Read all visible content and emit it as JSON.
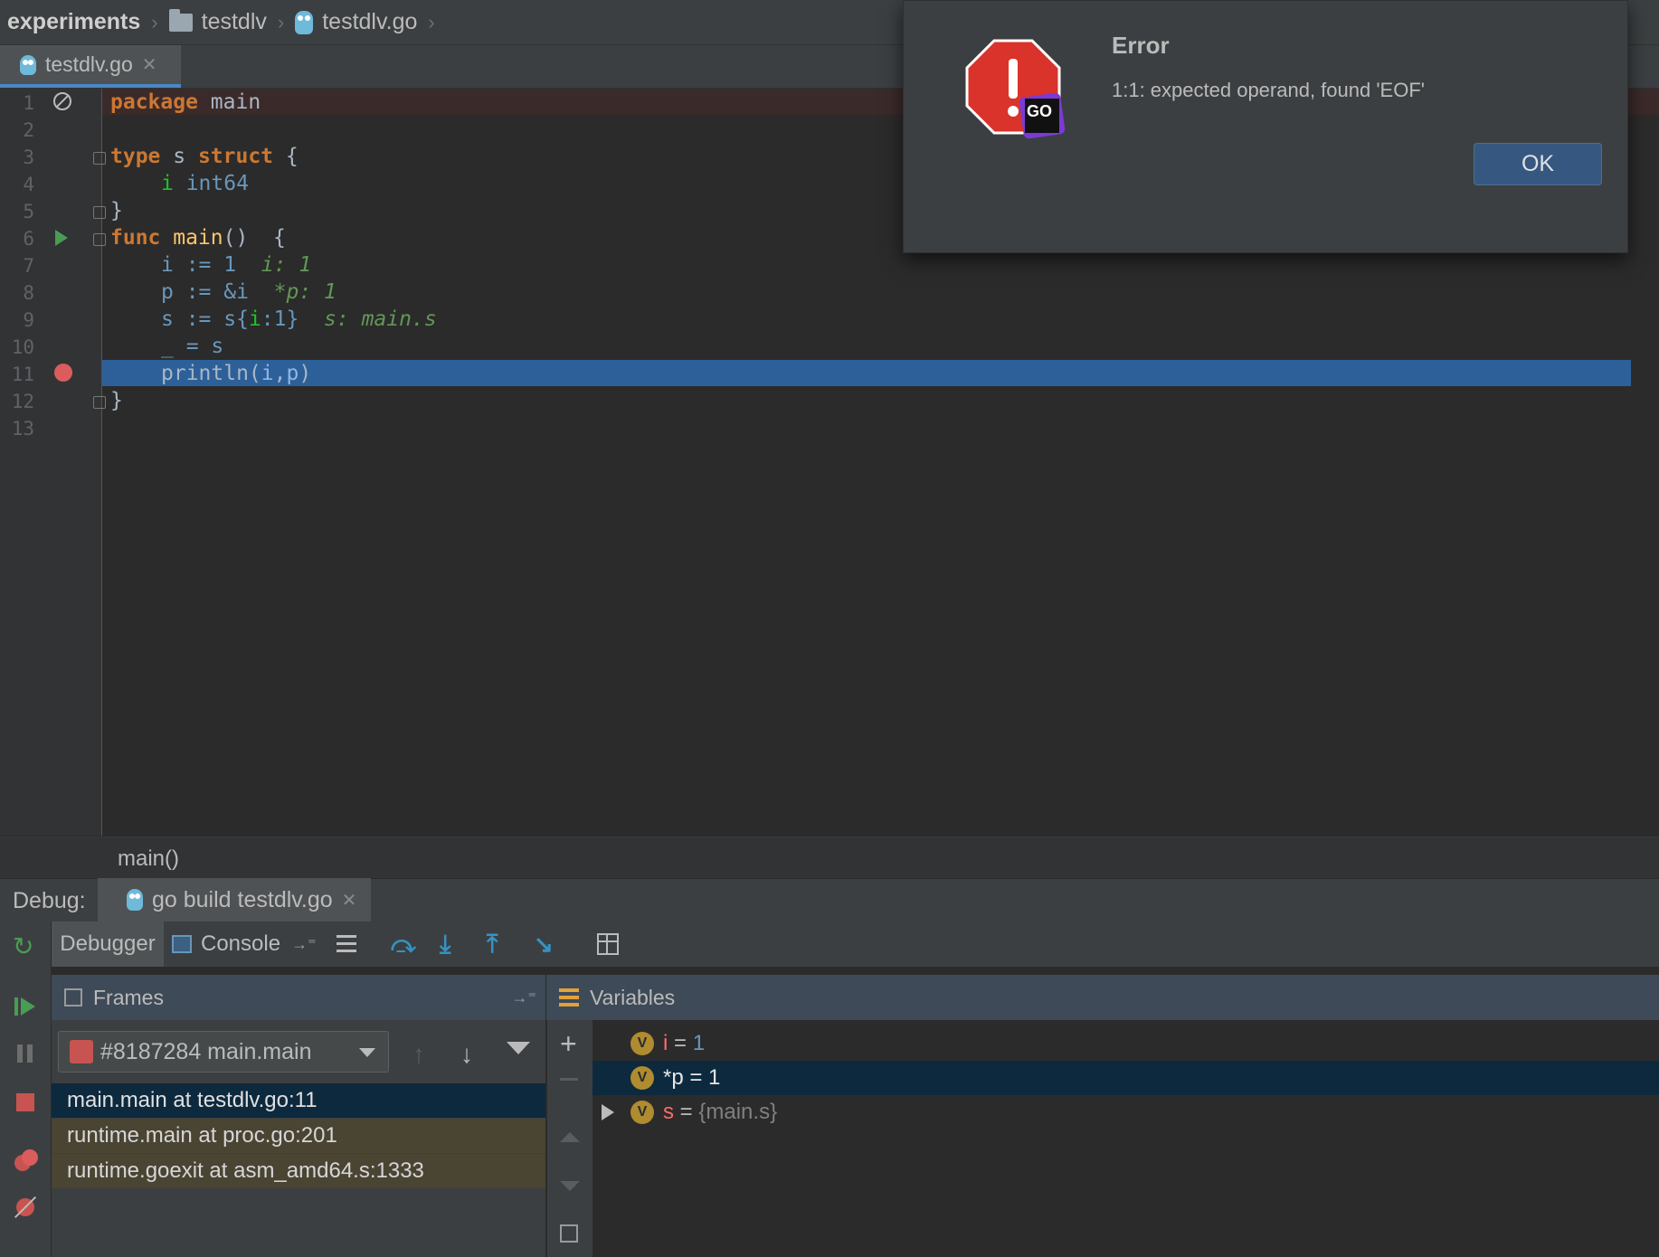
{
  "breadcrumb": {
    "project": "experiments",
    "folder": "testdlv",
    "file": "testdlv.go"
  },
  "editor_tab": {
    "label": "testdlv.go"
  },
  "editor": {
    "line_numbers": [
      "1",
      "2",
      "3",
      "4",
      "5",
      "6",
      "7",
      "8",
      "9",
      "10",
      "11",
      "12",
      "13"
    ],
    "code": {
      "l1_kw": "package",
      "l1_rest": " main",
      "l3_kw1": "type",
      "l3_mid": " s ",
      "l3_kw2": "struct",
      "l3_end": " {",
      "l4_field": "i",
      "l4_type": " int64",
      "l5": "}",
      "l6_kw": "func",
      "l6_name": " main",
      "l6_rest": "()  {",
      "l7_code": "i := 1",
      "l7_hint": "i: 1",
      "l8_code": "p := &i",
      "l8_hint": "*p: 1",
      "l9_code_a": "s := s{",
      "l9_code_b": "i",
      "l9_code_c": ":1}",
      "l9_hint": "s: main.s",
      "l10": "_ = s",
      "l11_a": "println(",
      "l11_b": "i",
      "l11_c": ",",
      "l11_d": "p",
      "l11_e": ")",
      "l12": "}"
    }
  },
  "footer_crumb": "main()",
  "debug": {
    "label": "Debug:",
    "session_tab": "go build testdlv.go",
    "tabs": {
      "debugger": "Debugger",
      "console": "Console"
    },
    "frames": {
      "header": "Frames",
      "thread": "#8187284 main.main",
      "rows": [
        "main.main at testdlv.go:11",
        "runtime.main at proc.go:201",
        "runtime.goexit at asm_amd64.s:1333"
      ]
    },
    "variables": {
      "header": "Variables",
      "rows": [
        {
          "badge": "V",
          "name": "i",
          "eq": " = ",
          "value": "1"
        },
        {
          "badge": "V",
          "name": "*p",
          "eq": " = ",
          "value": "1"
        },
        {
          "badge": "V",
          "name": "s",
          "eq": " = ",
          "value": "{main.s}"
        }
      ]
    }
  },
  "dialog": {
    "title": "Error",
    "message": "1:1: expected operand, found 'EOF'",
    "ok_label": "OK",
    "icon_text": "GO"
  },
  "colors": {
    "selection": "#2d6099",
    "keyword": "#cc7832",
    "breakpoint": "#db5c5c",
    "frame_selected": "#0d293e",
    "frame_other": "#4a4433"
  }
}
